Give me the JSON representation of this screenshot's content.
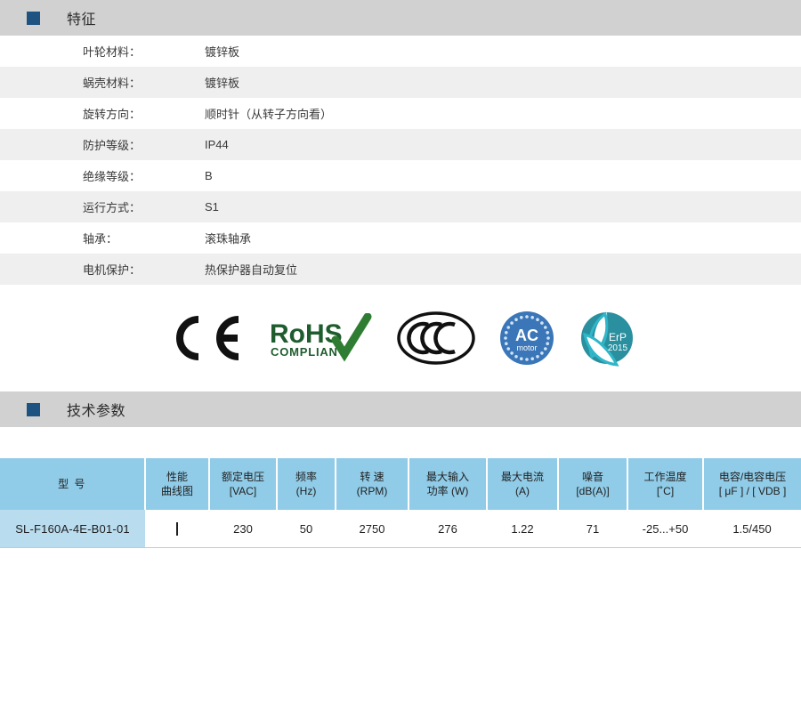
{
  "features_section": {
    "marker_color": "#1d5281",
    "title": "特征",
    "rows": [
      {
        "label": "叶轮材料：",
        "value": "镀锌板"
      },
      {
        "label": "蜗壳材料：",
        "value": "镀锌板"
      },
      {
        "label": "旋转方向：",
        "value": "顺时针（从转子方向看）"
      },
      {
        "label": "防护等级：",
        "value": "IP44"
      },
      {
        "label": "绝缘等级：",
        "value": "B"
      },
      {
        "label": "运行方式：",
        "value": "S1"
      },
      {
        "label": "轴承：",
        "value": "滚珠轴承"
      },
      {
        "label": "电机保护：",
        "value": "热保护器自动复位"
      }
    ]
  },
  "certifications": [
    {
      "name": "ce-logo",
      "label": "CE"
    },
    {
      "name": "rohs-logo",
      "label": "RoHS",
      "sublabel": "COMPLIANT"
    },
    {
      "name": "ccc-logo",
      "label": "CCC"
    },
    {
      "name": "ac-motor-logo",
      "label": "AC",
      "sublabel": "motor"
    },
    {
      "name": "erp-logo",
      "label": "ErP",
      "sublabel": "2015"
    }
  ],
  "tech_section": {
    "marker_color": "#1d5281",
    "title": "技术参数",
    "header_bg": "#90cbe7",
    "model_cell_bg": "#b9dcee",
    "columns": [
      {
        "line1": "型 号",
        "line2": ""
      },
      {
        "line1": "性能",
        "line2": "曲线图"
      },
      {
        "line1": "额定电压",
        "line2": "[VAC]"
      },
      {
        "line1": "频率",
        "line2": "(Hz)"
      },
      {
        "line1": "转 速",
        "line2": "(RPM)"
      },
      {
        "line1": "最大输入",
        "line2": "功率 (W)"
      },
      {
        "line1": "最大电流",
        "line2": "(A)"
      },
      {
        "line1": "噪音",
        "line2": "[dB(A)]"
      },
      {
        "line1": "工作温度",
        "line2": "[˚C]"
      },
      {
        "line1": "电容/电容电压",
        "line2": "[ μF ] / [ VDB ]"
      }
    ],
    "rows": [
      {
        "model": "SL-F160A-4E-B01-01",
        "curve": "I",
        "rated_voltage": "230",
        "frequency": "50",
        "speed": "2750",
        "max_input_power": "276",
        "max_current": "1.22",
        "noise": "71",
        "working_temperature": "-25...+50",
        "capacitor": "1.5/450"
      }
    ]
  }
}
